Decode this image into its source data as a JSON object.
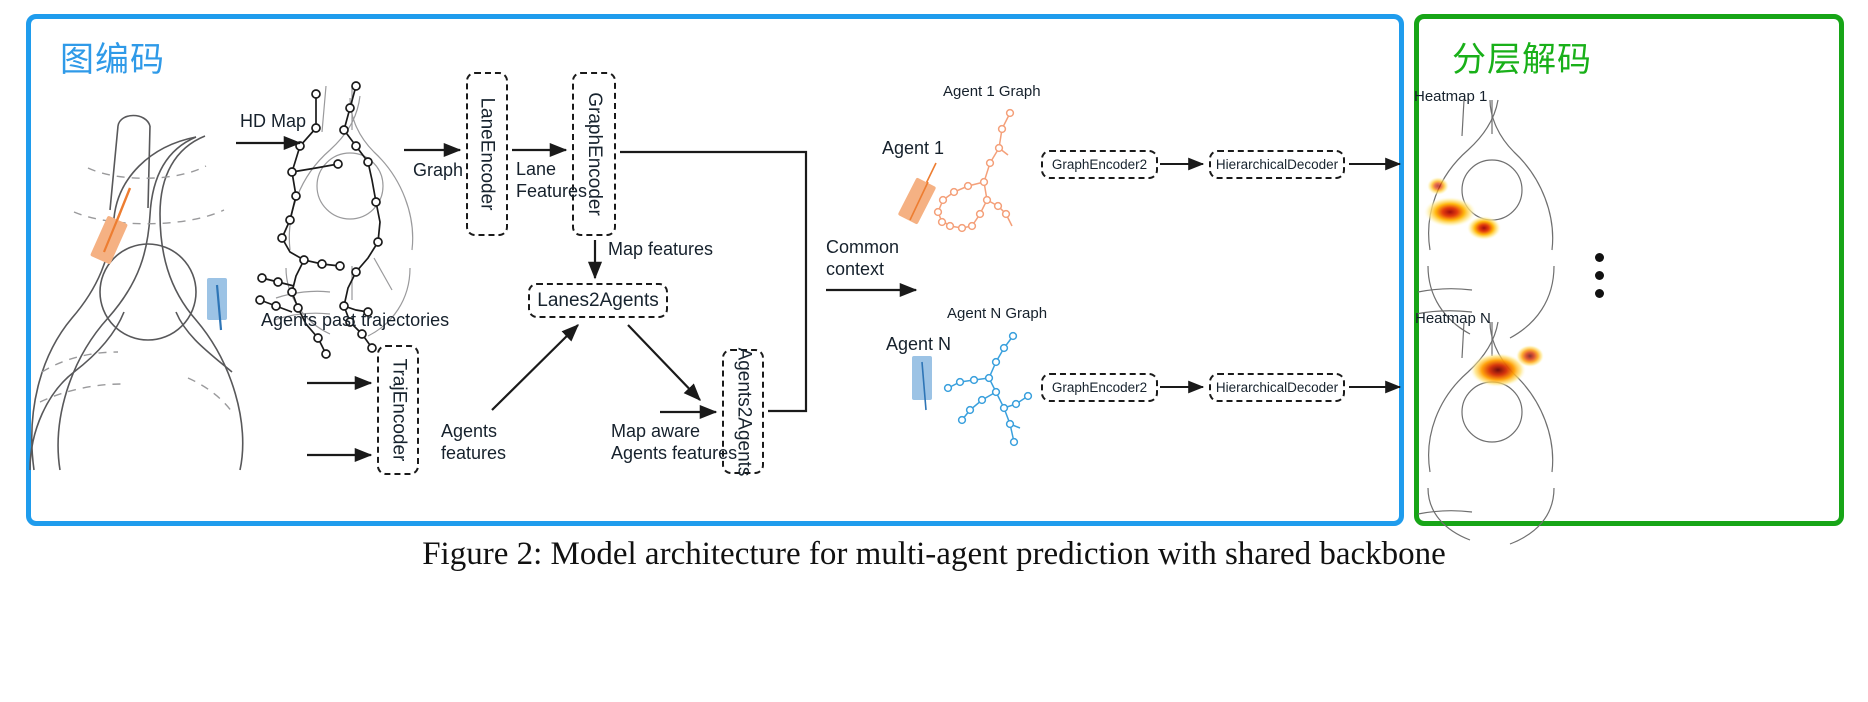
{
  "figure": {
    "caption": "Figure 2: Model architecture for multi-agent prediction with shared backbone"
  },
  "panels": {
    "encoder": {
      "title": "图编码",
      "color": "#1f9ced"
    },
    "decoder": {
      "title": "分层解码",
      "color": "#17a517"
    }
  },
  "modules": {
    "lane_encoder": "LaneEncoder",
    "graph_encoder": "GraphEncoder",
    "traj_encoder": "TrajEncoder",
    "lanes2agents": "Lanes2Agents",
    "agents2agents": "Agents2Agents",
    "graph_encoder2_top": "GraphEncoder2",
    "graph_encoder2_bottom": "GraphEncoder2",
    "hierarchical_decoder_top": "HierarchicalDecoder",
    "hierarchical_decoder_bottom": "HierarchicalDecoder"
  },
  "labels": {
    "hd_map": "HD Map",
    "graph": "Graph",
    "lane_features": "Lane\nFeatures",
    "map_features": "Map features",
    "agents_past_trajectories": "Agents past trajectories",
    "agents_features": "Agents\nfeatures",
    "map_aware_agents_features": "Map aware\nAgents features",
    "common_context": "Common\ncontext",
    "agent_1": "Agent 1",
    "agent_n": "Agent N",
    "agent_1_graph": "Agent 1 Graph",
    "agent_n_graph": "Agent N Graph",
    "heatmap_1": "Heatmap 1",
    "heatmap_n": "Heatmap N"
  },
  "colors": {
    "agent_orange": "#f5b183",
    "agent_blue": "#9cc3e5",
    "encoder_border": "#1f9ced",
    "decoder_border": "#17a517",
    "line": "#1a1a1a",
    "map_gray": "#6f6f6f"
  }
}
